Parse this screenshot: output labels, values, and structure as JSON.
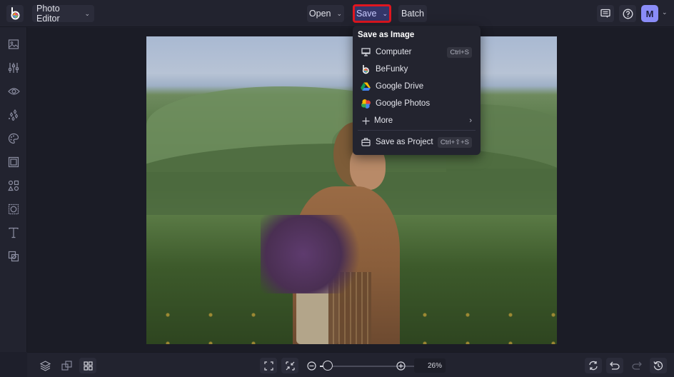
{
  "topbar": {
    "app_menu_label": "Photo Editor",
    "open_label": "Open",
    "save_label": "Save",
    "batch_label": "Batch",
    "avatar_initial": "M",
    "icons": [
      "befunky-logo-icon",
      "comments-icon",
      "help-icon"
    ]
  },
  "sidebar": {
    "items": [
      {
        "icon": "image-icon",
        "label": "Photo"
      },
      {
        "icon": "sliders-icon",
        "label": "Adjustments"
      },
      {
        "icon": "eye-icon",
        "label": "Touch Up"
      },
      {
        "icon": "sparkles-icon",
        "label": "Effects"
      },
      {
        "icon": "palette-icon",
        "label": "Artsy"
      },
      {
        "icon": "frame-icon",
        "label": "Frames"
      },
      {
        "icon": "shapes-icon",
        "label": "Graphics"
      },
      {
        "icon": "overlay-icon",
        "label": "Overlays"
      },
      {
        "icon": "text-icon",
        "label": "Text"
      },
      {
        "icon": "textures-icon",
        "label": "Textures"
      }
    ]
  },
  "save_menu": {
    "header": "Save as Image",
    "items": [
      {
        "label": "Computer",
        "icon": "monitor-icon",
        "shortcut": "Ctrl+S"
      },
      {
        "label": "BeFunky",
        "icon": "befunky-icon",
        "shortcut": ""
      },
      {
        "label": "Google Drive",
        "icon": "google-drive-icon",
        "shortcut": ""
      },
      {
        "label": "Google Photos",
        "icon": "google-photos-icon",
        "shortcut": ""
      },
      {
        "label": "More",
        "icon": "plus-icon",
        "shortcut": "",
        "submenu": true
      },
      {
        "label": "Save as Project",
        "icon": "briefcase-icon",
        "shortcut": "Ctrl+⇧+S"
      }
    ]
  },
  "bottombar": {
    "left_icons": [
      "layers-icon",
      "compare-icon",
      "grid-icon"
    ],
    "zoom_value": "26%",
    "zoom_percent": 26,
    "right_icons": [
      "refresh-icon",
      "undo-icon",
      "redo-icon",
      "history-icon"
    ]
  },
  "colors": {
    "accent": "#8a8cf7",
    "save_highlight": "#e0161f",
    "background": "#1e1f2b"
  }
}
